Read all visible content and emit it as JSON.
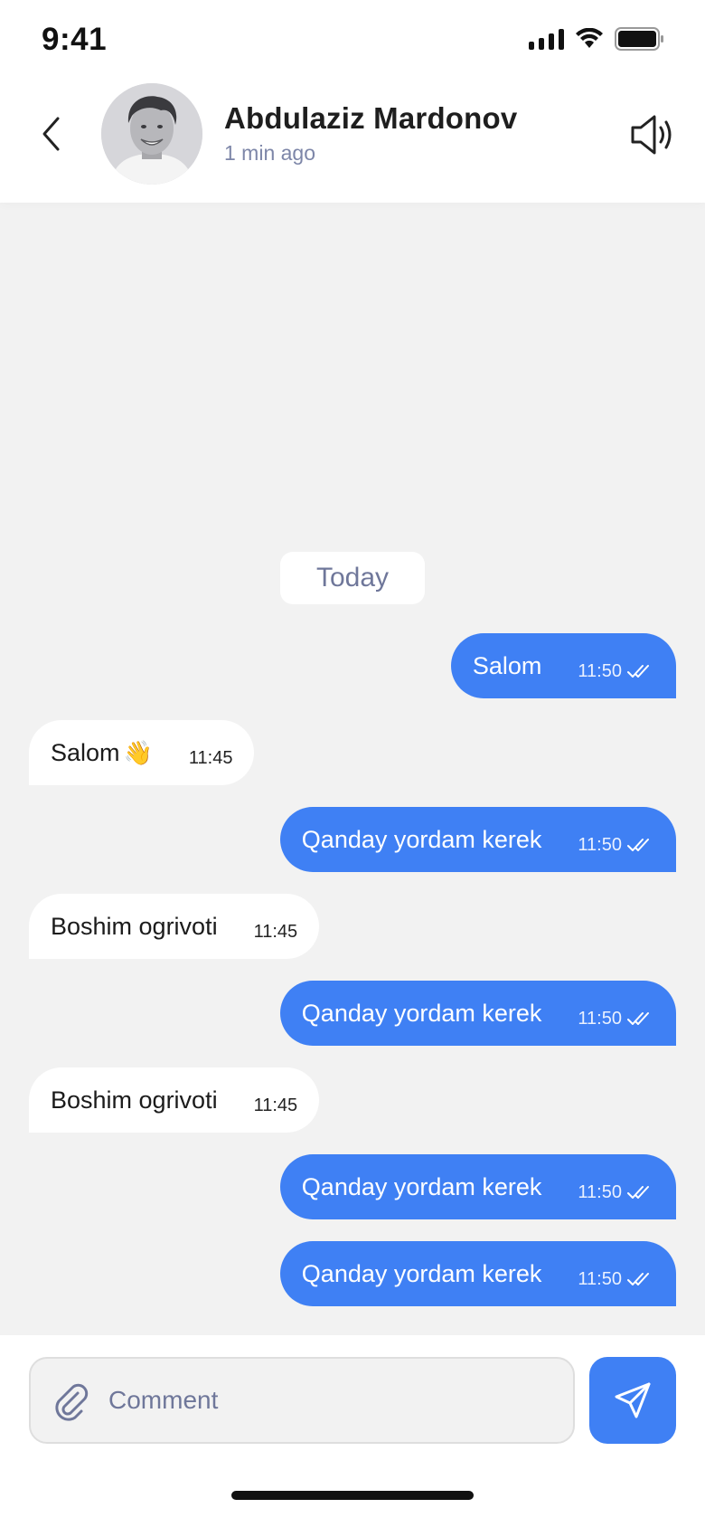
{
  "status_bar": {
    "time": "9:41"
  },
  "header": {
    "contact_name": "Abdulaziz Mardonov",
    "contact_status": "1 min ago",
    "back_icon": "chevron-left-icon",
    "sound_icon": "speaker-icon"
  },
  "chat": {
    "date_label": "Today",
    "messages": [
      {
        "direction": "out",
        "text": "Salom",
        "time": "11:50",
        "status_icon": "double-check-icon"
      },
      {
        "direction": "in",
        "text": "Salom",
        "emoji": "👋",
        "time": "11:45"
      },
      {
        "direction": "out",
        "text": "Qanday yordam kerek",
        "time": "11:50",
        "status_icon": "double-check-icon"
      },
      {
        "direction": "in",
        "text": "Boshim ogrivoti",
        "time": "11:45"
      },
      {
        "direction": "out",
        "text": "Qanday yordam kerek",
        "time": "11:50",
        "status_icon": "double-check-icon"
      },
      {
        "direction": "in",
        "text": "Boshim ogrivoti",
        "time": "11:45"
      },
      {
        "direction": "out",
        "text": "Qanday yordam kerek",
        "time": "11:50",
        "status_icon": "double-check-icon"
      },
      {
        "direction": "out",
        "text": "Qanday yordam kerek",
        "time": "11:50",
        "status_icon": "double-check-icon"
      }
    ]
  },
  "composer": {
    "placeholder": "Comment",
    "value": "",
    "attach_icon": "paperclip-icon",
    "send_icon": "send-icon"
  },
  "colors": {
    "accent": "#3f80f4",
    "background": "#f2f2f2",
    "muted_text": "#6f779a"
  }
}
